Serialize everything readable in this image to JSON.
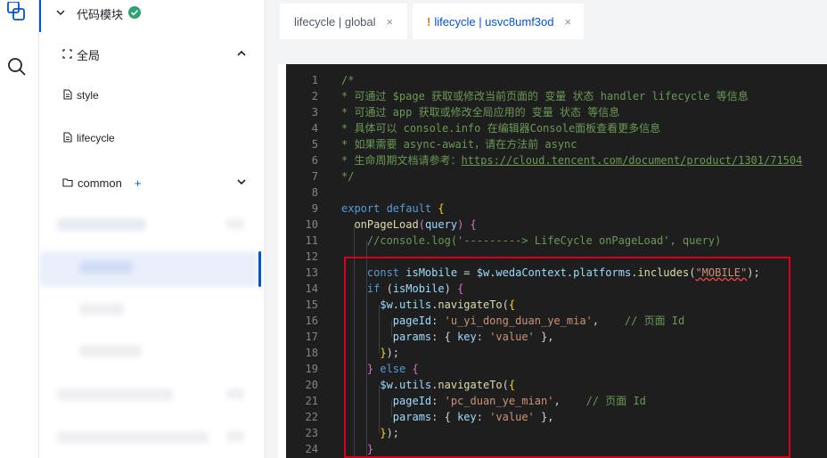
{
  "sidebar": {
    "section_title": "代码模块",
    "global_label": "全局",
    "items": [
      {
        "label": "style"
      },
      {
        "label": "lifecycle"
      }
    ],
    "common_label": "common",
    "add_symbol": "+"
  },
  "tabs": [
    {
      "label": "lifecycle | global",
      "close": "×"
    },
    {
      "label": "lifecycle | usvc8umf3od",
      "close": "×",
      "modified": "!"
    }
  ],
  "editor": {
    "lines": [
      {
        "n": "1",
        "segs": [
          [
            "c-comment",
            "/*"
          ]
        ]
      },
      {
        "n": "2",
        "segs": [
          [
            "c-comment",
            "* 可通过 $page 获取或修改当前页面的 变量 状态 handler lifecycle 等信息"
          ]
        ]
      },
      {
        "n": "3",
        "segs": [
          [
            "c-comment",
            "* 可通过 app 获取或修改全局应用的 变量 状态 等信息"
          ]
        ]
      },
      {
        "n": "4",
        "segs": [
          [
            "c-comment",
            "* 具体可以 console.info 在编辑器Console面板查看更多信息"
          ]
        ]
      },
      {
        "n": "5",
        "segs": [
          [
            "c-comment",
            "* 如果需要 async-await，请在方法前 async"
          ]
        ]
      },
      {
        "n": "6",
        "segs": [
          [
            "c-comment",
            "* 生命周期文档请参考："
          ],
          [
            "c-link",
            "https://cloud.tencent.com/document/product/1301/71504"
          ]
        ]
      },
      {
        "n": "7",
        "segs": [
          [
            "c-comment",
            "*/"
          ]
        ]
      },
      {
        "n": "8",
        "segs": []
      },
      {
        "n": "9",
        "segs": [
          [
            "c-kw",
            "export default "
          ],
          [
            "c-brace",
            "{"
          ]
        ]
      },
      {
        "n": "10",
        "segs": [
          [
            "c-fn",
            "  onPageLoad"
          ],
          [
            "c-brace2",
            "("
          ],
          [
            "c-var",
            "query"
          ],
          [
            "c-brace2",
            ")"
          ],
          [
            "c-plain",
            " "
          ],
          [
            "c-brace2",
            "{"
          ]
        ]
      },
      {
        "n": "11",
        "segs": [
          [
            "c-comment",
            "    //console.log('---------> LifeCycle onPageLoad', query)"
          ]
        ]
      },
      {
        "n": "12",
        "segs": []
      },
      {
        "n": "13",
        "segs": [
          [
            "c-kw",
            "    const "
          ],
          [
            "c-var",
            "isMobile"
          ],
          [
            "c-plain",
            " = "
          ],
          [
            "c-var",
            "$w"
          ],
          [
            "c-plain",
            "."
          ],
          [
            "c-var",
            "wedaContext"
          ],
          [
            "c-plain",
            "."
          ],
          [
            "c-var",
            "platforms"
          ],
          [
            "c-plain",
            "."
          ],
          [
            "c-fn",
            "includes"
          ],
          [
            "c-plain",
            "("
          ],
          [
            "c-str",
            "\"MOBILE\""
          ],
          [
            "c-plain",
            ");"
          ]
        ]
      },
      {
        "n": "14",
        "segs": [
          [
            "c-kw",
            "    if "
          ],
          [
            "c-plain",
            "("
          ],
          [
            "c-var",
            "isMobile"
          ],
          [
            "c-plain",
            ") "
          ],
          [
            "c-brace2",
            "{"
          ]
        ]
      },
      {
        "n": "15",
        "segs": [
          [
            "c-var",
            "      $w"
          ],
          [
            "c-plain",
            "."
          ],
          [
            "c-var",
            "utils"
          ],
          [
            "c-plain",
            "."
          ],
          [
            "c-fn",
            "navigateTo"
          ],
          [
            "c-plain",
            "("
          ],
          [
            "c-brace",
            "{"
          ]
        ]
      },
      {
        "n": "16",
        "segs": [
          [
            "c-var",
            "        pageId"
          ],
          [
            "c-plain",
            ": "
          ],
          [
            "c-str",
            "'u_yi_dong_duan_ye_mia'"
          ],
          [
            "c-plain",
            ",    "
          ],
          [
            "c-comment",
            "// 页面 Id"
          ]
        ]
      },
      {
        "n": "17",
        "segs": [
          [
            "c-var",
            "        params"
          ],
          [
            "c-plain",
            ": { "
          ],
          [
            "c-var",
            "key"
          ],
          [
            "c-plain",
            ": "
          ],
          [
            "c-str",
            "'value'"
          ],
          [
            "c-plain",
            " },"
          ]
        ]
      },
      {
        "n": "18",
        "segs": [
          [
            "c-brace",
            "      }"
          ],
          [
            "c-plain",
            ");"
          ]
        ]
      },
      {
        "n": "19",
        "segs": [
          [
            "c-brace2",
            "    }"
          ],
          [
            "c-kw",
            " else "
          ],
          [
            "c-brace2",
            "{"
          ]
        ]
      },
      {
        "n": "20",
        "segs": [
          [
            "c-var",
            "      $w"
          ],
          [
            "c-plain",
            "."
          ],
          [
            "c-var",
            "utils"
          ],
          [
            "c-plain",
            "."
          ],
          [
            "c-fn",
            "navigateTo"
          ],
          [
            "c-plain",
            "("
          ],
          [
            "c-brace",
            "{"
          ]
        ]
      },
      {
        "n": "21",
        "segs": [
          [
            "c-var",
            "        pageId"
          ],
          [
            "c-plain",
            ": "
          ],
          [
            "c-str",
            "'pc_duan_ye_mian'"
          ],
          [
            "c-plain",
            ",    "
          ],
          [
            "c-comment",
            "// 页面 Id"
          ]
        ]
      },
      {
        "n": "22",
        "segs": [
          [
            "c-var",
            "        params"
          ],
          [
            "c-plain",
            ": { "
          ],
          [
            "c-var",
            "key"
          ],
          [
            "c-plain",
            ": "
          ],
          [
            "c-str",
            "'value'"
          ],
          [
            "c-plain",
            " },"
          ]
        ]
      },
      {
        "n": "23",
        "segs": [
          [
            "c-brace",
            "      }"
          ],
          [
            "c-plain",
            ");"
          ]
        ]
      },
      {
        "n": "24",
        "segs": [
          [
            "c-brace2",
            "    }"
          ]
        ]
      }
    ]
  },
  "colors": {
    "accent": "#0052d9",
    "success": "#2ba471",
    "highlight_border": "#d9001b",
    "editor_bg": "#1e1e1e"
  }
}
